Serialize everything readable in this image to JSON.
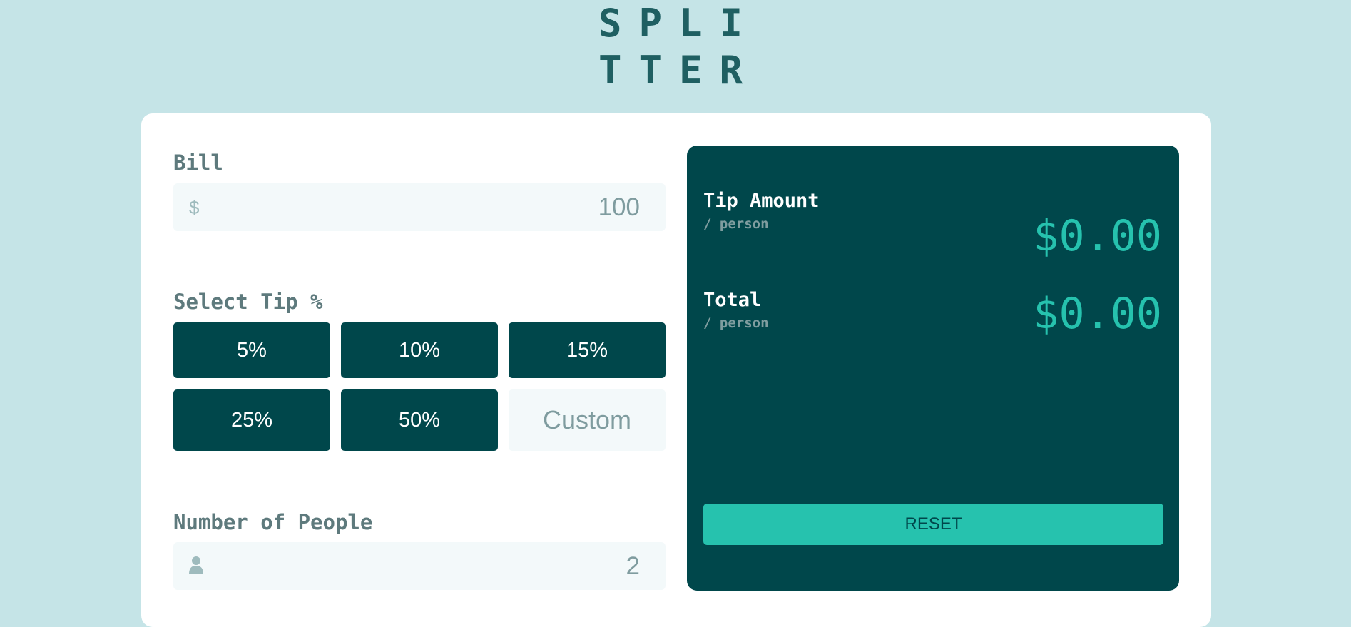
{
  "app": {
    "logo_text": "SPLI\nTTER"
  },
  "bill": {
    "label": "Bill",
    "currency_symbol": "$",
    "value": "100"
  },
  "tip": {
    "label": "Select Tip %",
    "options": [
      "5%",
      "10%",
      "15%",
      "25%",
      "50%"
    ],
    "custom_placeholder": "Custom"
  },
  "people": {
    "label": "Number of People",
    "value": "2",
    "icon": "person-icon"
  },
  "results": {
    "tip_amount": {
      "title": "Tip Amount",
      "sub": "/ person",
      "value": "$0.00"
    },
    "total": {
      "title": "Total",
      "sub": "/ person",
      "value": "$0.00"
    },
    "reset_label": "RESET"
  },
  "colors": {
    "background": "#c5e4e7",
    "dark_cyan": "#00474b",
    "strong_cyan": "#26c2ae",
    "input_bg": "#f3f9fa"
  }
}
